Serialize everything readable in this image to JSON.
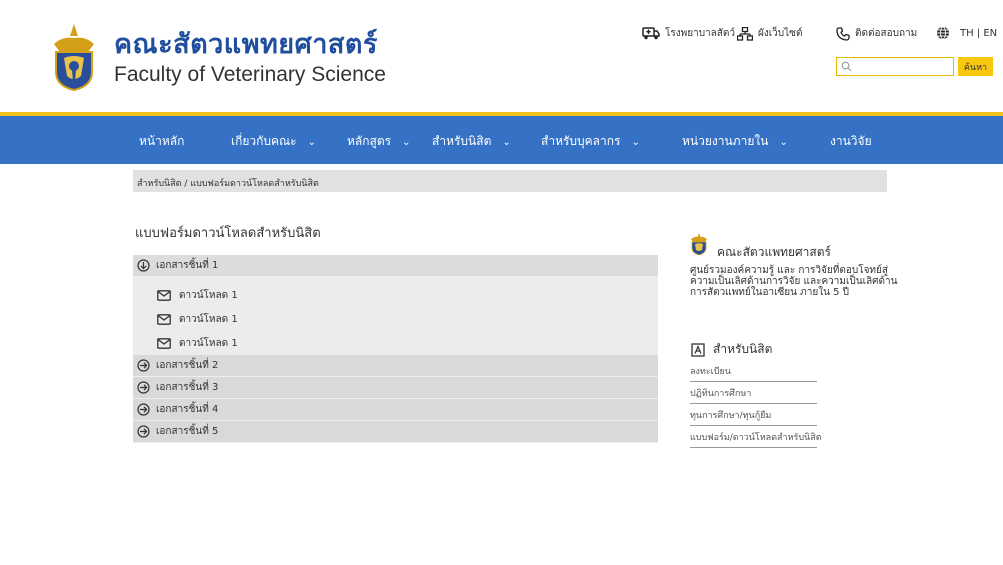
{
  "brand": {
    "name_th": "คณะสัตวแพทยศาสตร์",
    "name_en": "Faculty of Veterinary Science"
  },
  "toplinks": {
    "hospital": "โรงพยาบาลสัตว์",
    "sitemap": "ผังเว็บไซต์",
    "contact": "ติดต่อสอบถาม",
    "lang": "TH | EN"
  },
  "search": {
    "placeholder": "",
    "button_label": "ค้นหา"
  },
  "nav": {
    "items": [
      {
        "label": "หน้าหลัก",
        "has_dropdown": false
      },
      {
        "label": "เกี่ยวกับคณะ",
        "has_dropdown": true
      },
      {
        "label": "หลักสูตร",
        "has_dropdown": true
      },
      {
        "label": "สำหรับนิสิต",
        "has_dropdown": true
      },
      {
        "label": "สำหรับบุคลากร",
        "has_dropdown": true
      },
      {
        "label": "หน่วยงานภายใน",
        "has_dropdown": true
      },
      {
        "label": "งานวิจัย",
        "has_dropdown": false
      }
    ],
    "chevron": "⌄"
  },
  "breadcrumb": "สำหรับนิสิต / แบบฟอร์มดาวน์โหลดสำหรับนิสิต",
  "main": {
    "title": "แบบฟอร์มดาวน์โหลดสำหรับนิสิต",
    "documents": [
      {
        "label": "เอกสารชิ้นที่ 1",
        "expanded": true,
        "downloads": [
          "ดาวน์โหลด 1",
          "ดาวน์โหลด 1",
          "ดาวน์โหลด 1"
        ]
      },
      {
        "label": "เอกสารชิ้นที่ 2",
        "expanded": false
      },
      {
        "label": "เอกสารชิ้นที่ 3",
        "expanded": false
      },
      {
        "label": "เอกสารชิ้นที่ 4",
        "expanded": false
      },
      {
        "label": "เอกสารชิ้นที่ 5",
        "expanded": false
      }
    ]
  },
  "sidebar": {
    "brand": "คณะสัตวแพทยศาสตร์",
    "description": "ศูนย์รวมองค์ความรู้ และ การวิจัยที่ตอบโจทย์สู่ความเป็นเลิศด้านการวิจัย และความเป็นเลิศด้านการสัตวแพทย์ในอาเซียน ภายใน 5 ปี",
    "section_title": "สำหรับนิสิต",
    "links": [
      "ลงทะเบียน",
      "ปฏิทินการศึกษา",
      "ทุนการศึกษา/ทุนกู้ยืม",
      "แบบฟอร์ม/ดาวน์โหลดสำหรับนิสิต"
    ]
  },
  "colors": {
    "nav_blue": "#3572c6",
    "brand_blue": "#1f4e9e",
    "accent_gold": "#f2c21b"
  }
}
